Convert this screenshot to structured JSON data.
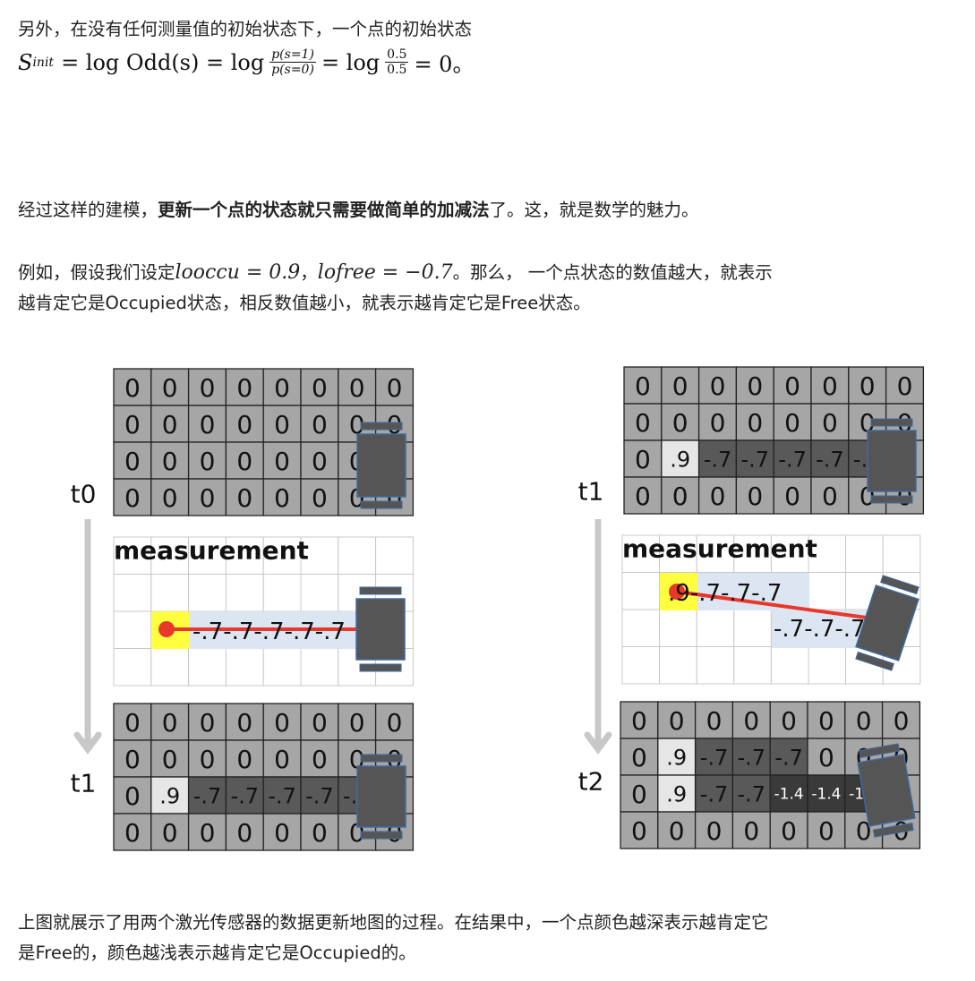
{
  "intro_line": "另外，在没有任何测量值的初始状态下，一个点的初始状态",
  "formula": {
    "lhs": "S",
    "lhs_sub": "init",
    "eq1": "= log Odd(s) = log",
    "frac1_num": "p(s=1)",
    "frac1_den": "p(s=0)",
    "eq2": "= log",
    "frac2_num": "0.5",
    "frac2_den": "0.5",
    "eq3": "= 0。"
  },
  "para2": {
    "pre": "经过这样的建模，",
    "bold": "更新一个点的状态就只需要做简单的加减法",
    "post": "了。这，就是数学的魅力。"
  },
  "para3": {
    "pre": "例如，假设我们设定",
    "m1": "looccu = 0.9",
    "sep": "，",
    "m2": "lofree = −0.7",
    "line1_post": "。那么， 一个点状态的数值越大，就表示",
    "line2": "越肯定它是Occupied状态，相反数值越小，就表示越肯定它是Free状态。"
  },
  "figure": {
    "left": {
      "t_top": "t0",
      "t_bottom": "t1",
      "measurement_label": "measurement",
      "grid_top": [
        [
          "0",
          "0",
          "0",
          "0",
          "0",
          "0",
          "0",
          "0"
        ],
        [
          "0",
          "0",
          "0",
          "0",
          "0",
          "0",
          "0",
          "0"
        ],
        [
          "0",
          "0",
          "0",
          "0",
          "0",
          "0",
          "0",
          "0"
        ],
        [
          "0",
          "0",
          "0",
          "0",
          "0",
          "0",
          "0",
          "0"
        ]
      ],
      "measurement_values": [
        ".-7",
        ".-7",
        ".-7",
        ".-7",
        ".-7"
      ],
      "measurement_text": "-.7-.7-.7-.7-.7",
      "grid_bottom": [
        [
          "0",
          "0",
          "0",
          "0",
          "0",
          "0",
          "0",
          "0"
        ],
        [
          "0",
          "0",
          "0",
          "0",
          "0",
          "0",
          "0",
          "0"
        ],
        [
          "0",
          ".9",
          "-.7",
          "-.7",
          "-.7",
          "-.7",
          "-.7",
          "0"
        ],
        [
          "0",
          "0",
          "0",
          "0",
          "0",
          "0",
          "0",
          "0"
        ]
      ]
    },
    "right": {
      "t_top": "t1",
      "t_bottom": "t2",
      "measurement_label": "measurement",
      "grid_top": [
        [
          "0",
          "0",
          "0",
          "0",
          "0",
          "0",
          "0",
          "0"
        ],
        [
          "0",
          "0",
          "0",
          "0",
          "0",
          "0",
          "0",
          "0"
        ],
        [
          "0",
          ".9",
          "-.7",
          "-.7",
          "-.7",
          "-.7",
          "-.7",
          "0"
        ],
        [
          "0",
          "0",
          "0",
          "0",
          "0",
          "0",
          "0",
          "0"
        ]
      ],
      "measurement_text_1": ".9-.7-.7-.7",
      "measurement_text_2": "-.7-.7-.7",
      "grid_bottom": [
        [
          "0",
          "0",
          "0",
          "0",
          "0",
          "0",
          "0",
          "0"
        ],
        [
          "0",
          ".9",
          "-.7",
          "-.7",
          "-.7",
          "0",
          "0",
          "0"
        ],
        [
          "0",
          ".9",
          "-.7",
          "-.7",
          "-1.4",
          "-1.4",
          "-1.4",
          "0"
        ],
        [
          "0",
          "0",
          "0",
          "0",
          "0",
          "0",
          "0",
          "0"
        ]
      ]
    }
  },
  "closing": {
    "line1": "上图就展示了用两个激光传感器的数据更新地图的过程。在结果中，一个点颜色越深表示越肯定它",
    "line2": "是Free的，颜色越浅表示越肯定它是Occupied的。"
  },
  "colors": {
    "cell_unknown": "#a6a6a6",
    "cell_free": "#595959",
    "cell_free_dark": "#3a3a3a",
    "cell_occupied": "#e6e6e6",
    "measure_free": "#dce6f2",
    "measure_hit": "#ffff3f",
    "laser": "#e8382b",
    "robot": "#555555"
  }
}
